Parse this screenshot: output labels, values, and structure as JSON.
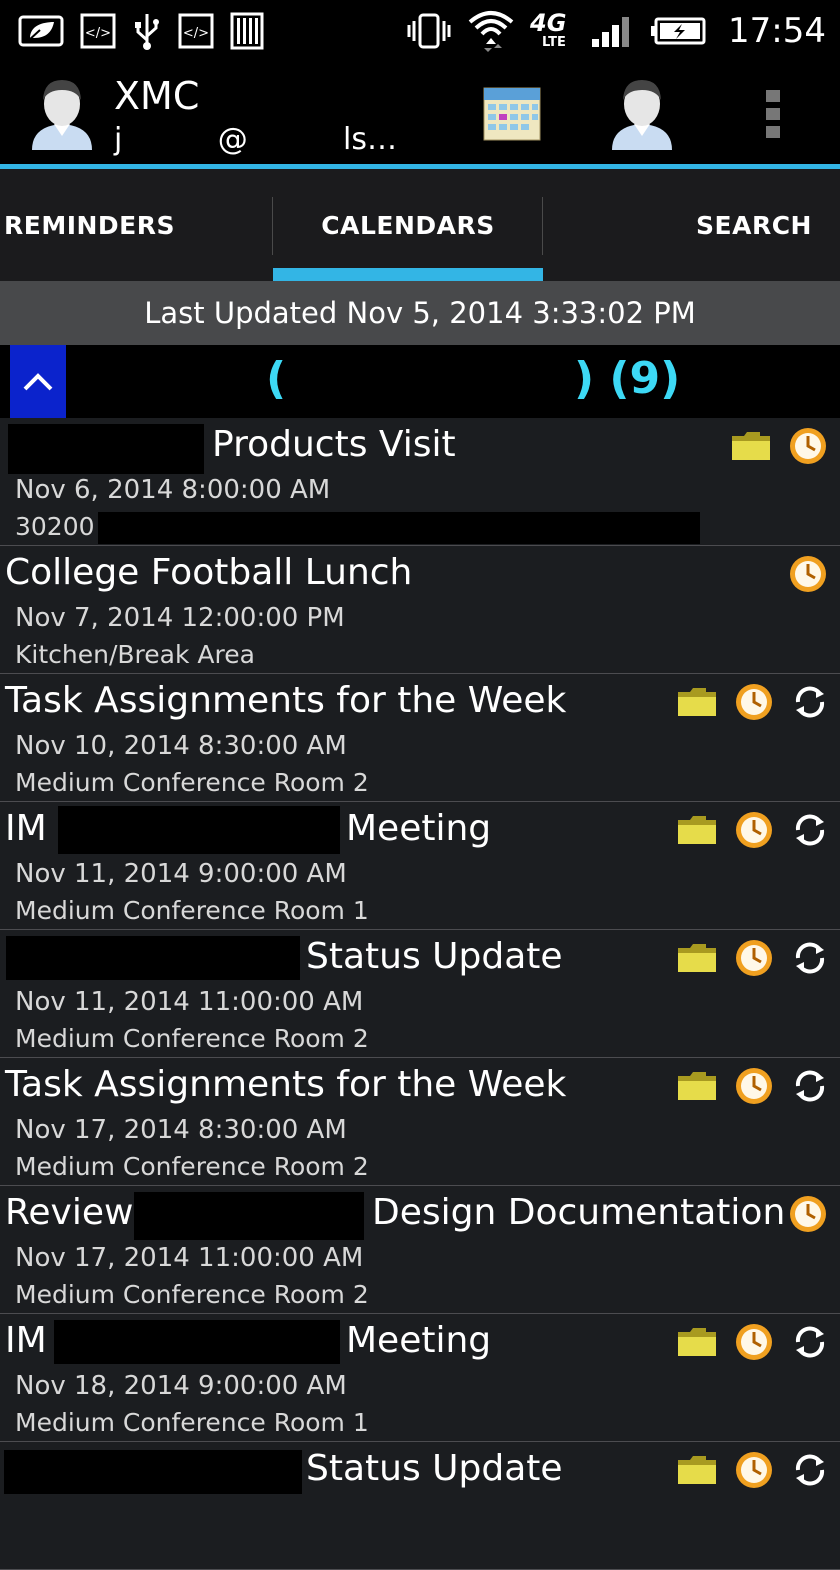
{
  "status_bar": {
    "time": "17:54",
    "network": "4G",
    "network_sub": "LTE",
    "icons": [
      "leaf-icon",
      "code-icon",
      "usb-icon",
      "code-icon",
      "barcode-icon",
      "vibrate-icon",
      "wifi-icon",
      "signal-icon",
      "battery-charging-icon"
    ]
  },
  "action_bar": {
    "account_name": "XMC",
    "account_email": "j          @          ls…",
    "icons": [
      "avatar-icon",
      "calendar-icon",
      "avatar-icon",
      "overflow-menu-icon"
    ]
  },
  "tabs": [
    {
      "label": "REMINDERS",
      "active": false
    },
    {
      "label": "CALENDARS",
      "active": true
    },
    {
      "label": "SEARCH",
      "active": false
    }
  ],
  "last_updated": "Last Updated Nov 5, 2014 3:33:02 PM",
  "group": {
    "open_paren": "(",
    "close_count": ") (9)"
  },
  "events": [
    {
      "title": "Products Visit",
      "date": "Nov 6, 2014 8:00:00 AM",
      "location": "30200",
      "icons": [
        "folder",
        "clock"
      ]
    },
    {
      "title": "College Football Lunch",
      "date": "Nov 7, 2014 12:00:00 PM",
      "location": "Kitchen/Break Area",
      "icons": [
        "clock"
      ]
    },
    {
      "title": "Task Assignments for the Week",
      "date": "Nov 10, 2014 8:30:00 AM",
      "location": "Medium Conference Room 2",
      "icons": [
        "folder",
        "clock",
        "recurring"
      ]
    },
    {
      "title_prefix": "IM",
      "title": "Meeting",
      "date": "Nov 11, 2014 9:00:00 AM",
      "location": "Medium Conference Room 1",
      "icons": [
        "folder",
        "clock",
        "recurring"
      ]
    },
    {
      "title": "Status Update",
      "date": "Nov 11, 2014 11:00:00 AM",
      "location": "Medium Conference Room 2",
      "icons": [
        "folder",
        "clock",
        "recurring"
      ]
    },
    {
      "title": "Task Assignments for the Week",
      "date": "Nov 17, 2014 8:30:00 AM",
      "location": "Medium Conference Room 2",
      "icons": [
        "folder",
        "clock",
        "recurring"
      ]
    },
    {
      "title_prefix": "Review",
      "title": "Design Documentation",
      "date": "Nov 17, 2014 11:00:00 AM",
      "location": "Medium Conference Room 2",
      "icons": [
        "clock"
      ]
    },
    {
      "title_prefix": "IM",
      "title": "Meeting",
      "date": "Nov 18, 2014 9:00:00 AM",
      "location": "Medium Conference Room 1",
      "icons": [
        "folder",
        "clock",
        "recurring"
      ]
    },
    {
      "title": "Status Update",
      "date": "",
      "location": "",
      "icons": [
        "folder",
        "clock",
        "recurring"
      ]
    }
  ],
  "colors": {
    "accent": "#33b5e5",
    "group_text": "#3dd9f5",
    "toggle_bg": "#0b23cc",
    "folder": "#e6dc4a",
    "clock_ring": "#f0a020"
  }
}
